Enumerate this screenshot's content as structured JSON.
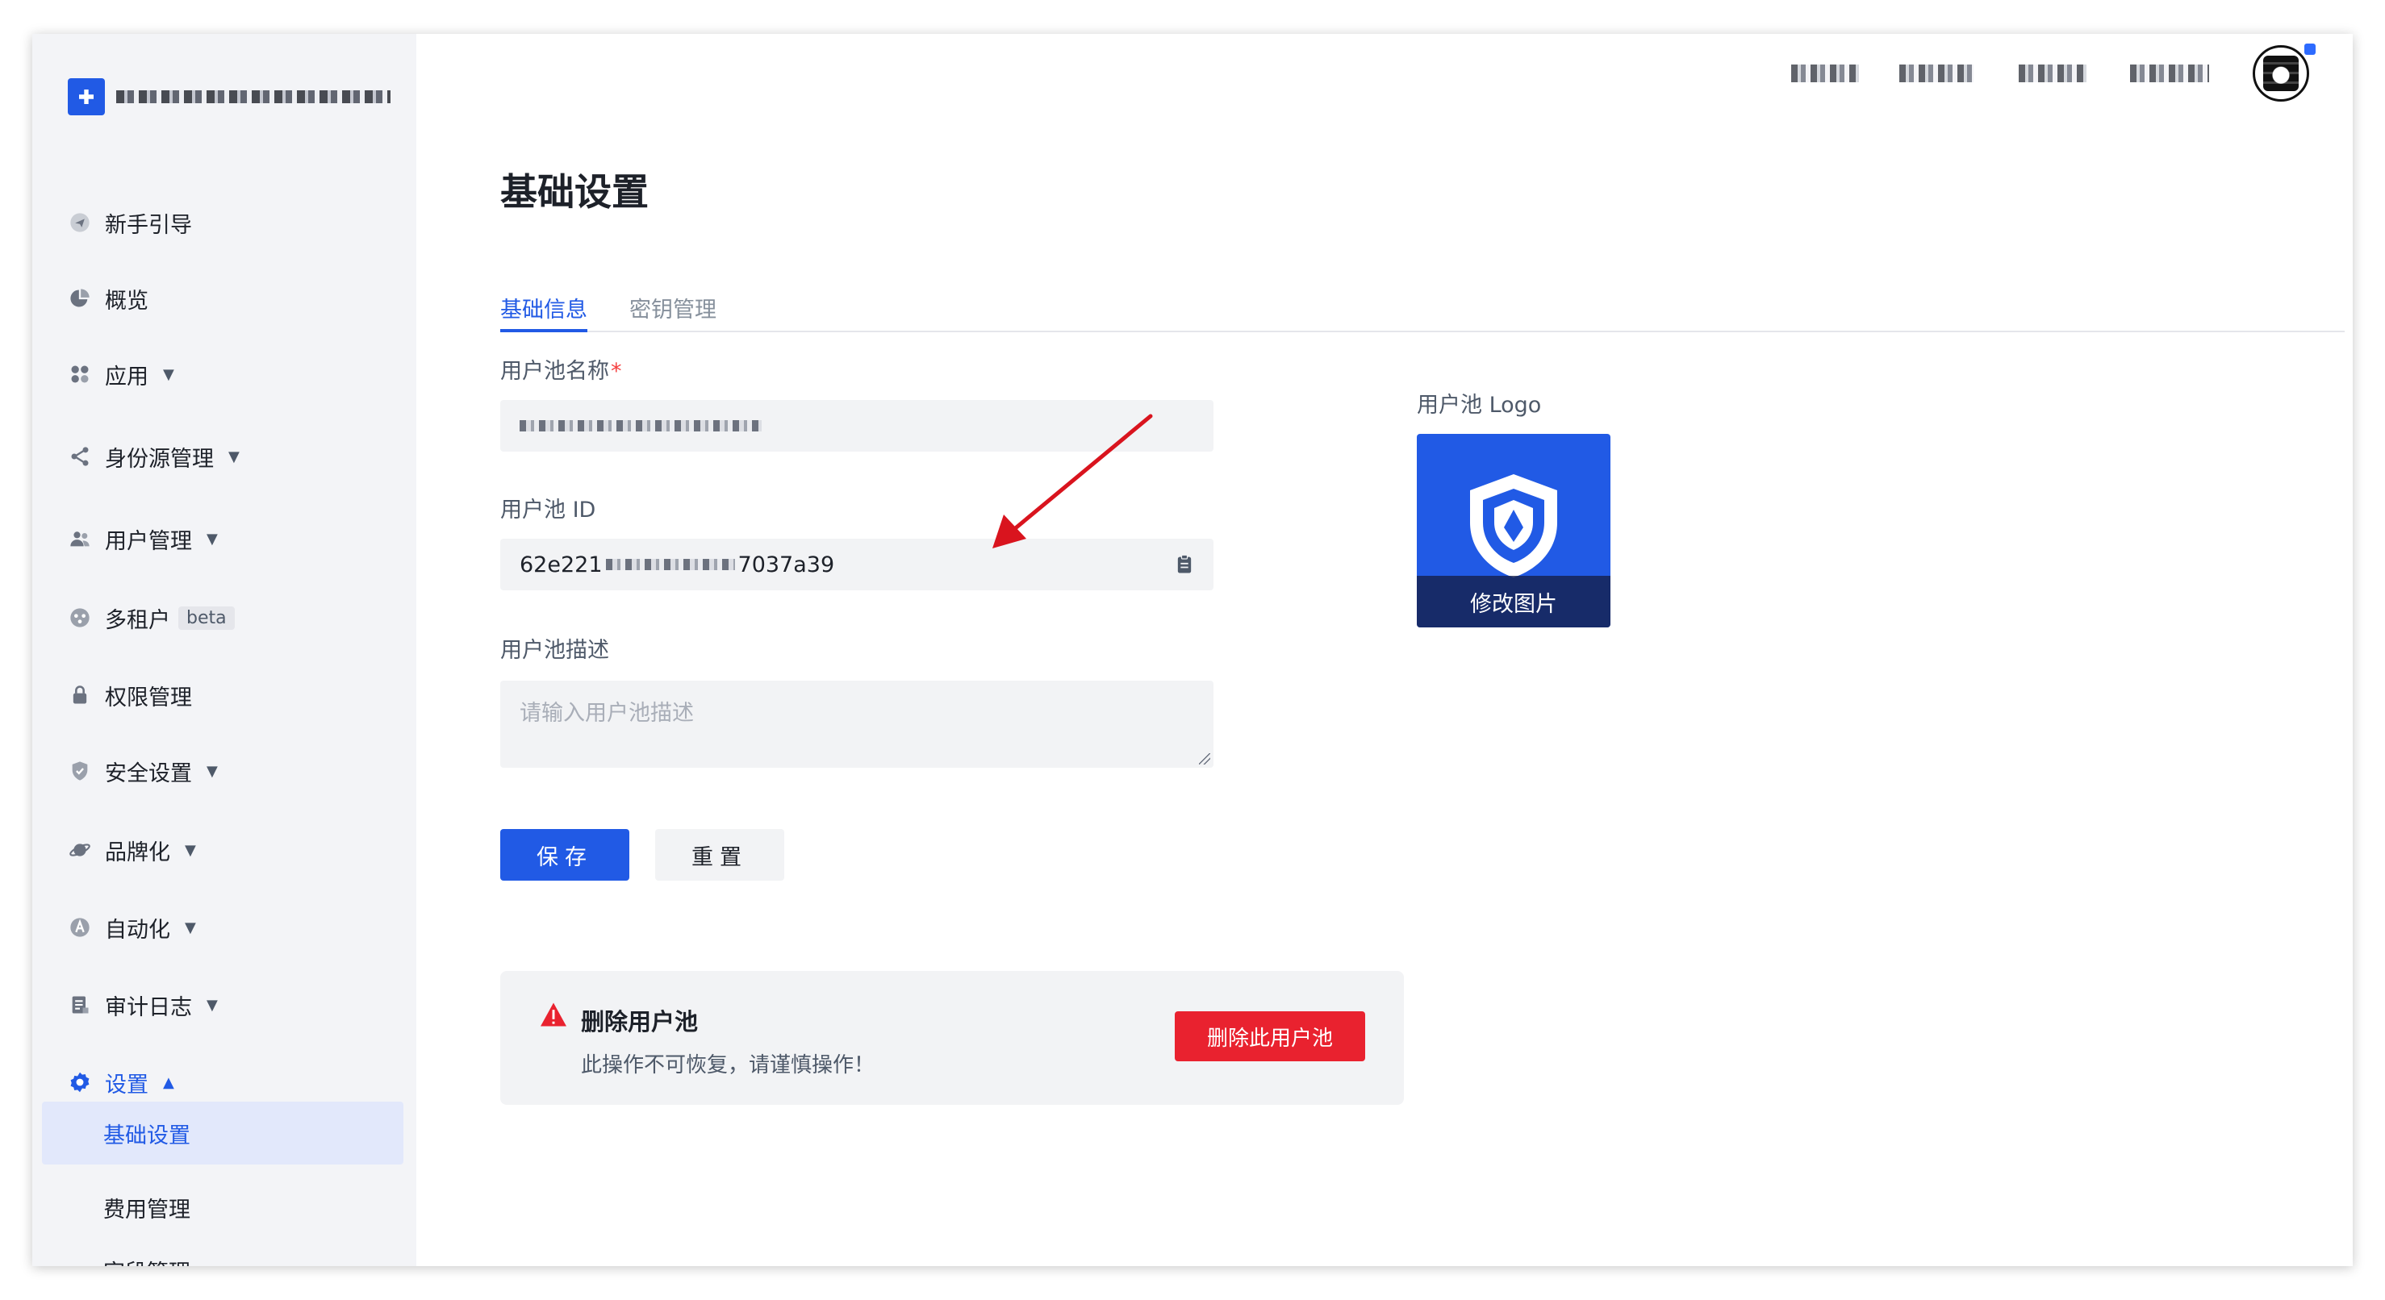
{
  "brand": {
    "name": ""
  },
  "sidebar": {
    "items": [
      {
        "label": "新手引导",
        "icon": "send-icon",
        "caret": ""
      },
      {
        "label": "概览",
        "icon": "pie-chart-icon",
        "caret": ""
      },
      {
        "label": "应用",
        "icon": "apps-icon",
        "caret": "▼"
      },
      {
        "label": "身份源管理",
        "icon": "share-icon",
        "caret": "▼"
      },
      {
        "label": "用户管理",
        "icon": "users-icon",
        "caret": "▼"
      },
      {
        "label": "多租户",
        "icon": "tenant-icon",
        "caret": "",
        "tag": "beta"
      },
      {
        "label": "权限管理",
        "icon": "lock-icon",
        "caret": ""
      },
      {
        "label": "安全设置",
        "icon": "shield-icon",
        "caret": "▼"
      },
      {
        "label": "品牌化",
        "icon": "planet-icon",
        "caret": "▼"
      },
      {
        "label": "自动化",
        "icon": "automation-icon",
        "caret": "▼"
      },
      {
        "label": "审计日志",
        "icon": "log-icon",
        "caret": "▼"
      },
      {
        "label": "设置",
        "icon": "gear-icon",
        "caret": "▲"
      }
    ],
    "sub_items": [
      {
        "label": "基础设置"
      },
      {
        "label": "费用管理"
      },
      {
        "label": "字段管理"
      }
    ]
  },
  "page": {
    "title": "基础设置",
    "tabs": [
      "基础信息",
      "密钥管理"
    ]
  },
  "form": {
    "name_label": "用户池名称",
    "required_mark": "*",
    "id_label": "用户池 ID",
    "id_value_start": "62e221",
    "id_value_end": "7037a39",
    "desc_label": "用户池描述",
    "desc_placeholder": "请输入用户池描述",
    "save_label": "保存",
    "reset_label": "重置"
  },
  "logo": {
    "label": "用户池 Logo",
    "change_label": "修改图片"
  },
  "danger": {
    "title": "删除用户池",
    "desc": "此操作不可恢复，请谨慎操作！",
    "button": "删除此用户池"
  },
  "colors": {
    "primary": "#215ae5",
    "danger": "#e9222f",
    "annotation_arrow": "#d9141e"
  }
}
